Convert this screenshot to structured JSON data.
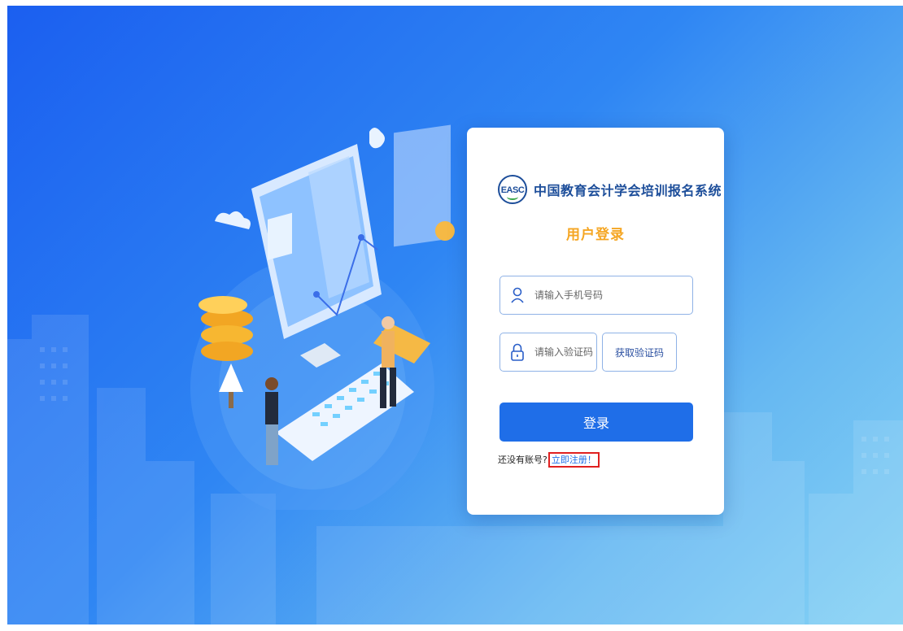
{
  "brand": {
    "logo_text": "EASC",
    "system_title": "中国教育会计学会培训报名系统"
  },
  "login": {
    "title": "用户登录",
    "phone_placeholder": "请输入手机号码",
    "code_placeholder": "请输入验证码",
    "get_code_label": "获取验证码",
    "submit_label": "登录",
    "no_account_text": "还没有账号?",
    "register_link": "立即注册！"
  },
  "icons": {
    "phone_field": "user-icon",
    "code_field": "lock-icon",
    "logo": "easc-logo"
  },
  "colors": {
    "primary": "#1f6ee8",
    "title_blue": "#1d4e9a",
    "accent_orange": "#f5a623",
    "field_border": "#8fb2e6",
    "highlight_red": "#e02020"
  }
}
